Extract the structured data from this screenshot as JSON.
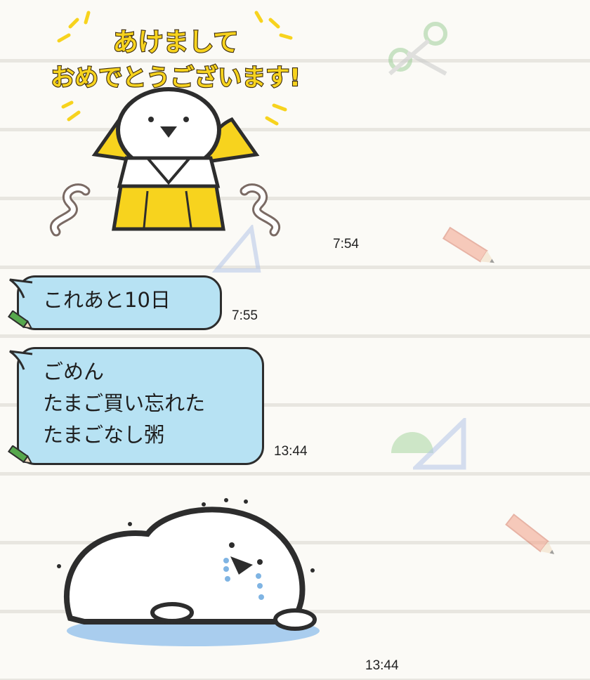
{
  "chat": {
    "messages": [
      {
        "type": "sticker",
        "sticker_text": [
          "あけまして",
          "おめでとうございます!"
        ],
        "time": "7:54"
      },
      {
        "type": "text",
        "lines": [
          "これあと10日"
        ],
        "time": "7:55"
      },
      {
        "type": "text",
        "lines": [
          "ごめん",
          "たまご買い忘れた",
          "たまごなし粥"
        ],
        "time": "13:44"
      },
      {
        "type": "sticker",
        "time": "13:44"
      }
    ]
  },
  "colors": {
    "bubble": "#b7e2f3",
    "background": "#fbfaf6",
    "sticker_yellow": "#f7d31e"
  },
  "icons": [
    "crying-bird-sticker-icon",
    "new-year-bird-sticker-icon",
    "pencil-icon",
    "scissors-icon",
    "triangle-ruler-icon",
    "protractor-icon"
  ]
}
